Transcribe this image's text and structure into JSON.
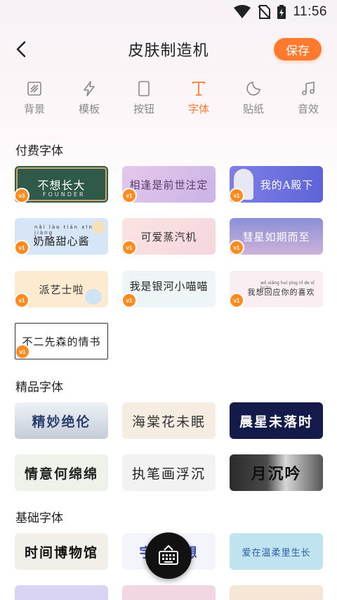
{
  "status": {
    "time": "11:56"
  },
  "header": {
    "title": "皮肤制造机",
    "save_label": "保存"
  },
  "tabs": [
    {
      "label": "背景",
      "icon": "background-icon"
    },
    {
      "label": "模板",
      "icon": "template-icon"
    },
    {
      "label": "按钮",
      "icon": "button-icon"
    },
    {
      "label": "字体",
      "icon": "font-icon",
      "active": true
    },
    {
      "label": "贴纸",
      "icon": "sticker-icon"
    },
    {
      "label": "音效",
      "icon": "sound-icon"
    }
  ],
  "sections": {
    "paid": "付费字体",
    "premium": "精品字体",
    "basic": "基础字体"
  },
  "paid_fonts": [
    {
      "text": "不想长大",
      "sub": "FOUNDER",
      "badge": "v3"
    },
    {
      "text": "相逢是前世注定",
      "badge": "v1"
    },
    {
      "text": "我的A殿下",
      "badge": "v1"
    },
    {
      "text": "奶酪甜心酱",
      "pinyin": "nǎi lào tián xīn jiàng",
      "badge": "v1"
    },
    {
      "text": "可爱蒸汽机",
      "badge": "v1"
    },
    {
      "text": "彗星如期而至",
      "badge": "v1"
    },
    {
      "text": "派艺士啦",
      "badge": "v1"
    },
    {
      "text": "我是银河小喵喵",
      "badge": "v1"
    },
    {
      "text": "我想回应你的喜欢",
      "pinyin": "wǒ xiǎng huí yìng nǐ de xǐ huān",
      "badge": "v1"
    },
    {
      "text": "不二先森的情书",
      "badge": "v1"
    }
  ],
  "premium_fonts": [
    {
      "text": "精妙绝伦"
    },
    {
      "text": "海棠花未眠"
    },
    {
      "text": "晨星未落时"
    },
    {
      "text": "情意何绵绵"
    },
    {
      "text": "执笔画浮沉"
    },
    {
      "text": "月沉吟"
    }
  ],
  "basic_fonts": [
    {
      "text": "时间博物馆"
    },
    {
      "text": "宇宙梦想"
    },
    {
      "text": "爱在温柔里生长"
    }
  ],
  "colors": {
    "accent": "#ff7a2e",
    "badge": "#ff8a1f"
  }
}
